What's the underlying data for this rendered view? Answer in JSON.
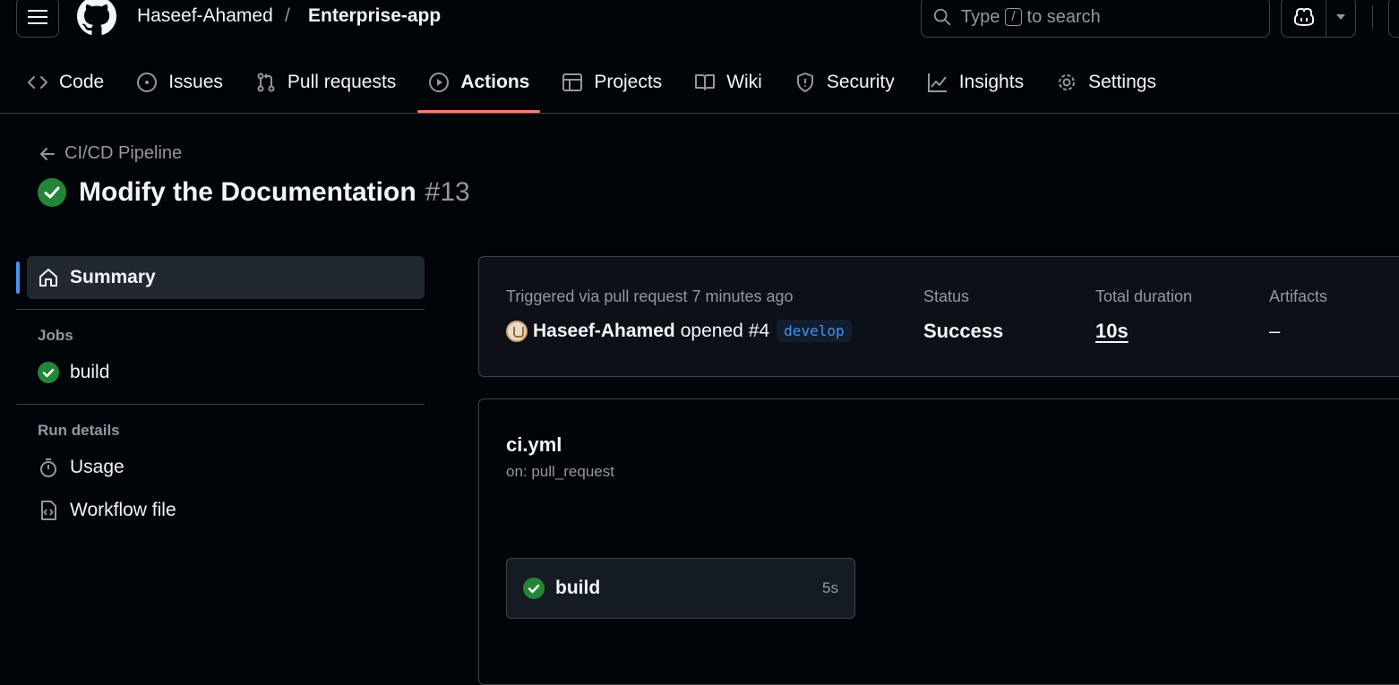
{
  "header": {
    "owner": "Haseef-Ahamed",
    "separator": "/",
    "repo": "Enterprise-app",
    "search_prefix": "Type",
    "search_key": "/",
    "search_suffix": "to search"
  },
  "tabs": [
    {
      "label": "Code",
      "icon": "code-icon"
    },
    {
      "label": "Issues",
      "icon": "issue-icon"
    },
    {
      "label": "Pull requests",
      "icon": "pull-request-icon"
    },
    {
      "label": "Actions",
      "icon": "play-icon",
      "active": true
    },
    {
      "label": "Projects",
      "icon": "table-icon"
    },
    {
      "label": "Wiki",
      "icon": "book-icon"
    },
    {
      "label": "Security",
      "icon": "shield-icon"
    },
    {
      "label": "Insights",
      "icon": "graph-icon"
    },
    {
      "label": "Settings",
      "icon": "gear-icon"
    }
  ],
  "run": {
    "back_label": "CI/CD Pipeline",
    "title": "Modify the Documentation",
    "number": "#13"
  },
  "sidebar": {
    "summary": "Summary",
    "jobs_heading": "Jobs",
    "jobs": [
      "build"
    ],
    "details_heading": "Run details",
    "usage": "Usage",
    "workflow_file": "Workflow file"
  },
  "summary_panel": {
    "trigger_label": "Triggered via pull request 7 minutes ago",
    "actor": "Haseef-Ahamed",
    "action": "opened",
    "pr": "#4",
    "branch": "develop",
    "status_label": "Status",
    "status_value": "Success",
    "duration_label": "Total duration",
    "duration_value": "10s",
    "artifacts_label": "Artifacts",
    "artifacts_value": "–"
  },
  "workflow": {
    "file": "ci.yml",
    "trigger": "on: pull_request",
    "job_name": "build",
    "job_time": "5s"
  },
  "colors": {
    "background": "#010409",
    "success": "#238636",
    "accent_tab": "#f78166",
    "link": "#4493f8"
  }
}
